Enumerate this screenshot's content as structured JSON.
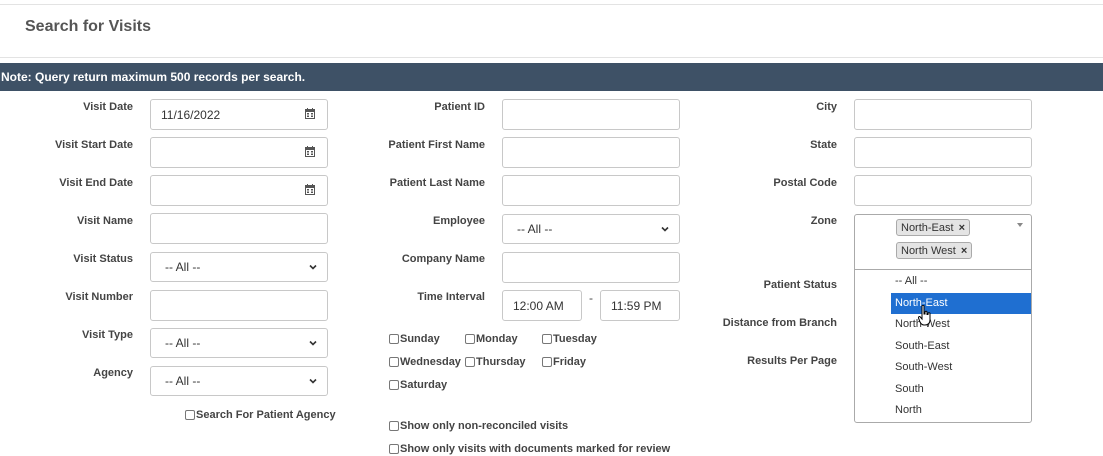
{
  "page": {
    "title": "Search for Visits",
    "note": "Note: Query return maximum 500 records per search."
  },
  "col1": {
    "visit_date_label": "Visit Date",
    "visit_date_value": "11/16/2022",
    "visit_start_date_label": "Visit Start Date",
    "visit_end_date_label": "Visit End Date",
    "visit_name_label": "Visit Name",
    "visit_status_label": "Visit Status",
    "visit_status_value": "-- All --",
    "visit_number_label": "Visit Number",
    "visit_type_label": "Visit Type",
    "visit_type_value": "-- All --",
    "agency_label": "Agency",
    "agency_value": "-- All --",
    "search_for_patient_agency": "Search For Patient Agency"
  },
  "col2": {
    "patient_id_label": "Patient ID",
    "patient_first_name_label": "Patient First Name",
    "patient_last_name_label": "Patient Last Name",
    "employee_label": "Employee",
    "employee_value": "-- All --",
    "company_name_label": "Company Name",
    "time_interval_label": "Time Interval",
    "time_start": "12:00 AM",
    "time_separator": "-",
    "time_end": "11:59 PM",
    "days": [
      "Sunday",
      "Monday",
      "Tuesday",
      "Wednesday",
      "Thursday",
      "Friday",
      "Saturday"
    ],
    "show_non_reconciled": "Show only non-reconciled visits",
    "show_documents_review": "Show only visits with documents marked for review"
  },
  "col3": {
    "city_label": "City",
    "state_label": "State",
    "postal_code_label": "Postal Code",
    "zone_label": "Zone",
    "zone_selected": [
      "North-East",
      "North West"
    ],
    "zone_remove_glyph": "×",
    "patient_status_label": "Patient Status",
    "distance_label": "Distance from Branch",
    "results_per_page_label": "Results Per Page",
    "zone_options": [
      "-- All --",
      "North-East",
      "North West",
      "South-East",
      "South-West",
      "South",
      "North"
    ],
    "zone_highlighted": "North-East"
  },
  "colors": {
    "note_bar": "#3e5166",
    "highlight": "#1f6fd1"
  }
}
